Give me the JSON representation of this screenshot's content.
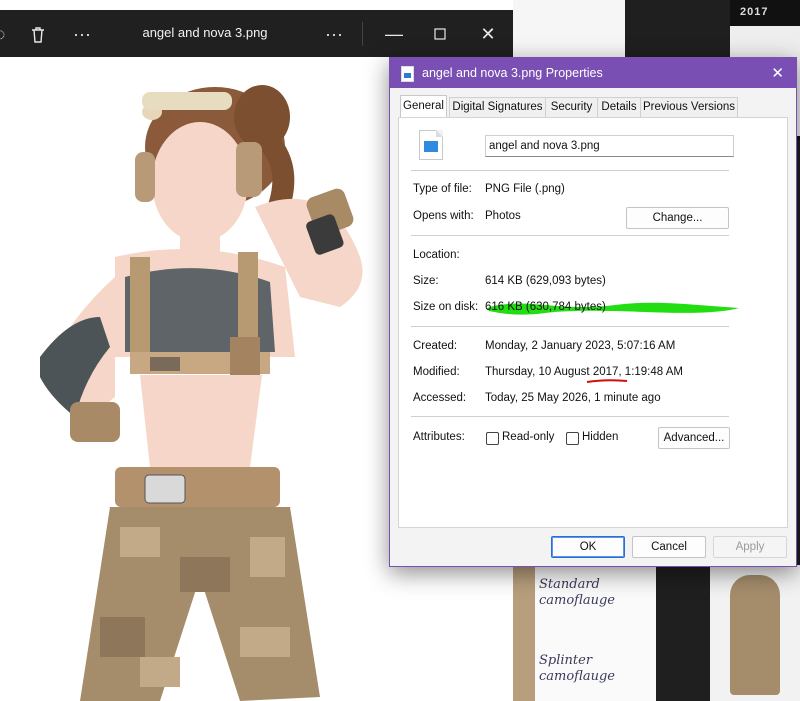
{
  "viewer": {
    "title": "angel and nova 3.png"
  },
  "background_art": {
    "label1_line1": "Standard",
    "label1_line2": "camoflauge",
    "label2_line1": "Splinter",
    "label2_line2": "camoflauge",
    "corner_text": "2017"
  },
  "dialog": {
    "title": "angel and nova 3.png Properties",
    "tabs": [
      "General",
      "Digital Signatures",
      "Security",
      "Details",
      "Previous Versions"
    ],
    "file_name": "angel and nova 3.png",
    "type_label": "Type of file:",
    "type_value": "PNG File (.png)",
    "opens_label": "Opens with:",
    "opens_value": "Photos",
    "change_button": "Change...",
    "location_label": "Location:",
    "size_label": "Size:",
    "size_value": "614 KB (629,093 bytes)",
    "size_on_disk_label": "Size on disk:",
    "size_on_disk_value": "616 KB (630,784 bytes)",
    "created_label": "Created:",
    "created_value": "Monday, 2 January 2023, 5:07:16 AM",
    "modified_label": "Modified:",
    "modified_value": "Thursday, 10 August 2017, 1:19:48 AM",
    "accessed_label": "Accessed:",
    "accessed_value": "Today, 25 May 2026, 1 minute ago",
    "attributes_label": "Attributes:",
    "readonly_label": "Read-only",
    "hidden_label": "Hidden",
    "advanced_button": "Advanced...",
    "ok_button": "OK",
    "cancel_button": "Cancel",
    "apply_button": "Apply"
  },
  "colors": {
    "dialog_accent": "#7a4fb3",
    "location_redaction": "#22dd11",
    "annotation_red": "#d01010"
  }
}
